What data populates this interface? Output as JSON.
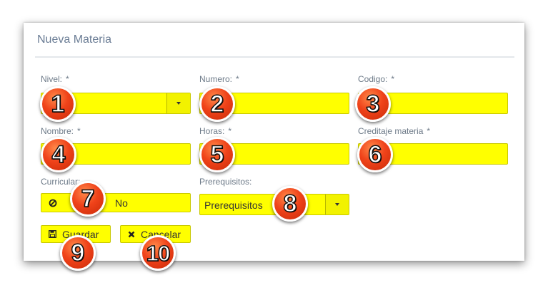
{
  "form": {
    "title": "Nueva Materia",
    "required_mark": "*",
    "fields": {
      "nivel": {
        "label": "Nivel:",
        "value": ""
      },
      "numero": {
        "label": "Numero:",
        "value": ""
      },
      "codigo": {
        "label": "Codigo:",
        "value": ""
      },
      "nombre": {
        "label": "Nombre:",
        "value": ""
      },
      "horas": {
        "label": "Horas:",
        "value": ""
      },
      "creditaje": {
        "label": "Creditaje materia",
        "value": ""
      },
      "curricular": {
        "label": "Curricular:",
        "value": "No"
      },
      "prerequisitos": {
        "label": "Prerequisitos:",
        "value": "Prerequisitos"
      }
    },
    "buttons": {
      "save_label": "Guardar",
      "cancel_label": "Cancelar"
    }
  },
  "annotations": [
    "1",
    "2",
    "3",
    "4",
    "5",
    "6",
    "7",
    "8",
    "9",
    "10"
  ],
  "colors": {
    "highlight": "#ffff00",
    "badge": "#f0431a",
    "title": "#6b7d95"
  }
}
